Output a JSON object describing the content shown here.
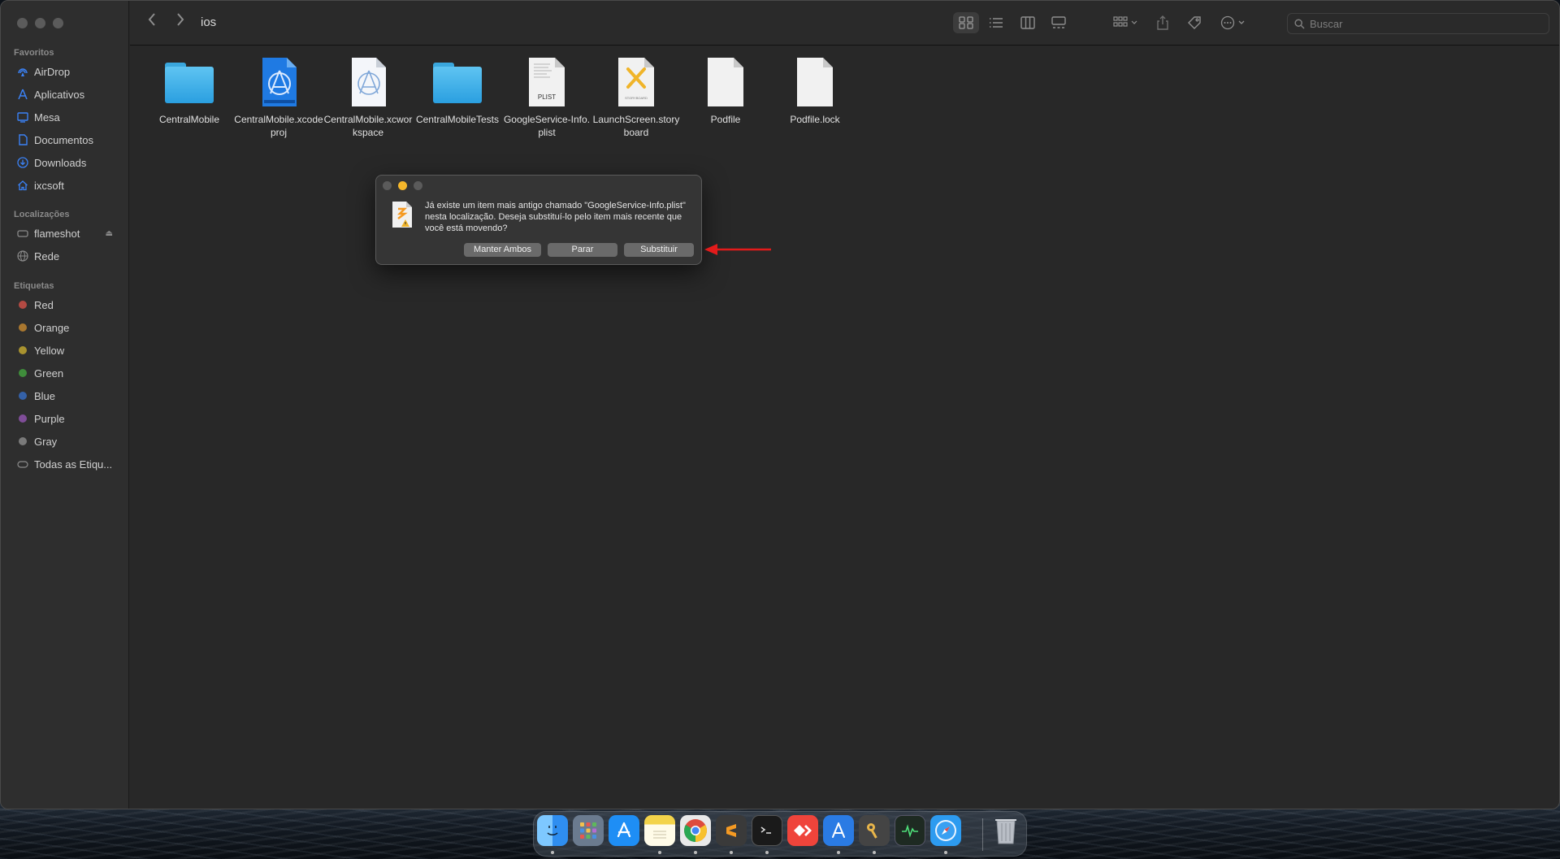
{
  "window": {
    "path_title": "ios"
  },
  "toolbar": {
    "search_placeholder": "Buscar",
    "icons": [
      "icon-view-grid",
      "icon-view-list",
      "icon-view-columns",
      "icon-view-gallery",
      "group-icon",
      "share-icon",
      "tag-icon",
      "more-icon"
    ]
  },
  "sidebar": {
    "favorites_heading": "Favoritos",
    "favorites": [
      {
        "label": "AirDrop",
        "icon": "airdrop-icon"
      },
      {
        "label": "Aplicativos",
        "icon": "applications-icon"
      },
      {
        "label": "Mesa",
        "icon": "desktop-icon"
      },
      {
        "label": "Documentos",
        "icon": "documents-icon"
      },
      {
        "label": "Downloads",
        "icon": "downloads-icon"
      },
      {
        "label": "ixcsoft",
        "icon": "home-icon"
      }
    ],
    "locations_heading": "Localizações",
    "locations": [
      {
        "label": "flameshot",
        "icon": "disk-icon"
      },
      {
        "label": "Rede",
        "icon": "network-icon"
      }
    ],
    "tags_heading": "Etiquetas",
    "tags": [
      {
        "label": "Red",
        "color": "#e2534a"
      },
      {
        "label": "Orange",
        "color": "#f09a37"
      },
      {
        "label": "Yellow",
        "color": "#e9c83b"
      },
      {
        "label": "Green",
        "color": "#5bbf55"
      },
      {
        "label": "Blue",
        "color": "#3b82f6"
      },
      {
        "label": "Purple",
        "color": "#b16bd2"
      },
      {
        "label": "Gray",
        "color": "#9a9a9a"
      }
    ],
    "all_tags_label": "Todas as Etiqu..."
  },
  "files": [
    {
      "name": "CentralMobile",
      "kind": "folder"
    },
    {
      "name": "CentralMobile.xcodeproj",
      "kind": "xcodeproj"
    },
    {
      "name": "CentralMobile.xcworkspace",
      "kind": "xcworkspace"
    },
    {
      "name": "CentralMobileTests",
      "kind": "folder"
    },
    {
      "name": "GoogleService-Info.plist",
      "kind": "plist",
      "badge": "PLIST"
    },
    {
      "name": "LaunchScreen.storyboard",
      "kind": "storyboard",
      "badge": "STORYBOARD"
    },
    {
      "name": "Podfile",
      "kind": "document"
    },
    {
      "name": "Podfile.lock",
      "kind": "document"
    }
  ],
  "dialog": {
    "message": "Já existe um item mais antigo chamado \"GoogleService-Info.plist\" nesta localização. Deseja substituí-lo pelo item mais recente que você está movendo?",
    "buttons": {
      "keep_both": "Manter Ambos",
      "stop": "Parar",
      "replace": "Substituir"
    }
  },
  "dock": {
    "apps": [
      {
        "name": "finder-icon",
        "color": "#2f8ef0",
        "running": true
      },
      {
        "name": "launchpad-icon",
        "color": "#6b7b8f",
        "running": false
      },
      {
        "name": "app-store-icon",
        "color": "#1e8ef5",
        "running": false
      },
      {
        "name": "notes-icon",
        "color": "#f3d34a",
        "running": true
      },
      {
        "name": "chrome-icon",
        "color": "#e9e9e9",
        "running": true
      },
      {
        "name": "sublime-text-icon",
        "color": "#3a3a3a",
        "running": true
      },
      {
        "name": "terminal-icon",
        "color": "#1a1a1a",
        "running": true
      },
      {
        "name": "anydesk-icon",
        "color": "#ef443b",
        "running": false
      },
      {
        "name": "xcode-icon",
        "color": "#2a7be4",
        "running": true
      },
      {
        "name": "keychain-icon",
        "color": "#444444",
        "running": true
      },
      {
        "name": "activity-monitor-icon",
        "color": "#1e2a22",
        "running": false
      },
      {
        "name": "safari-icon",
        "color": "#2d9bf0",
        "running": true
      },
      {
        "name": "trash-icon",
        "color": "#9aa0a8",
        "running": false
      }
    ]
  }
}
